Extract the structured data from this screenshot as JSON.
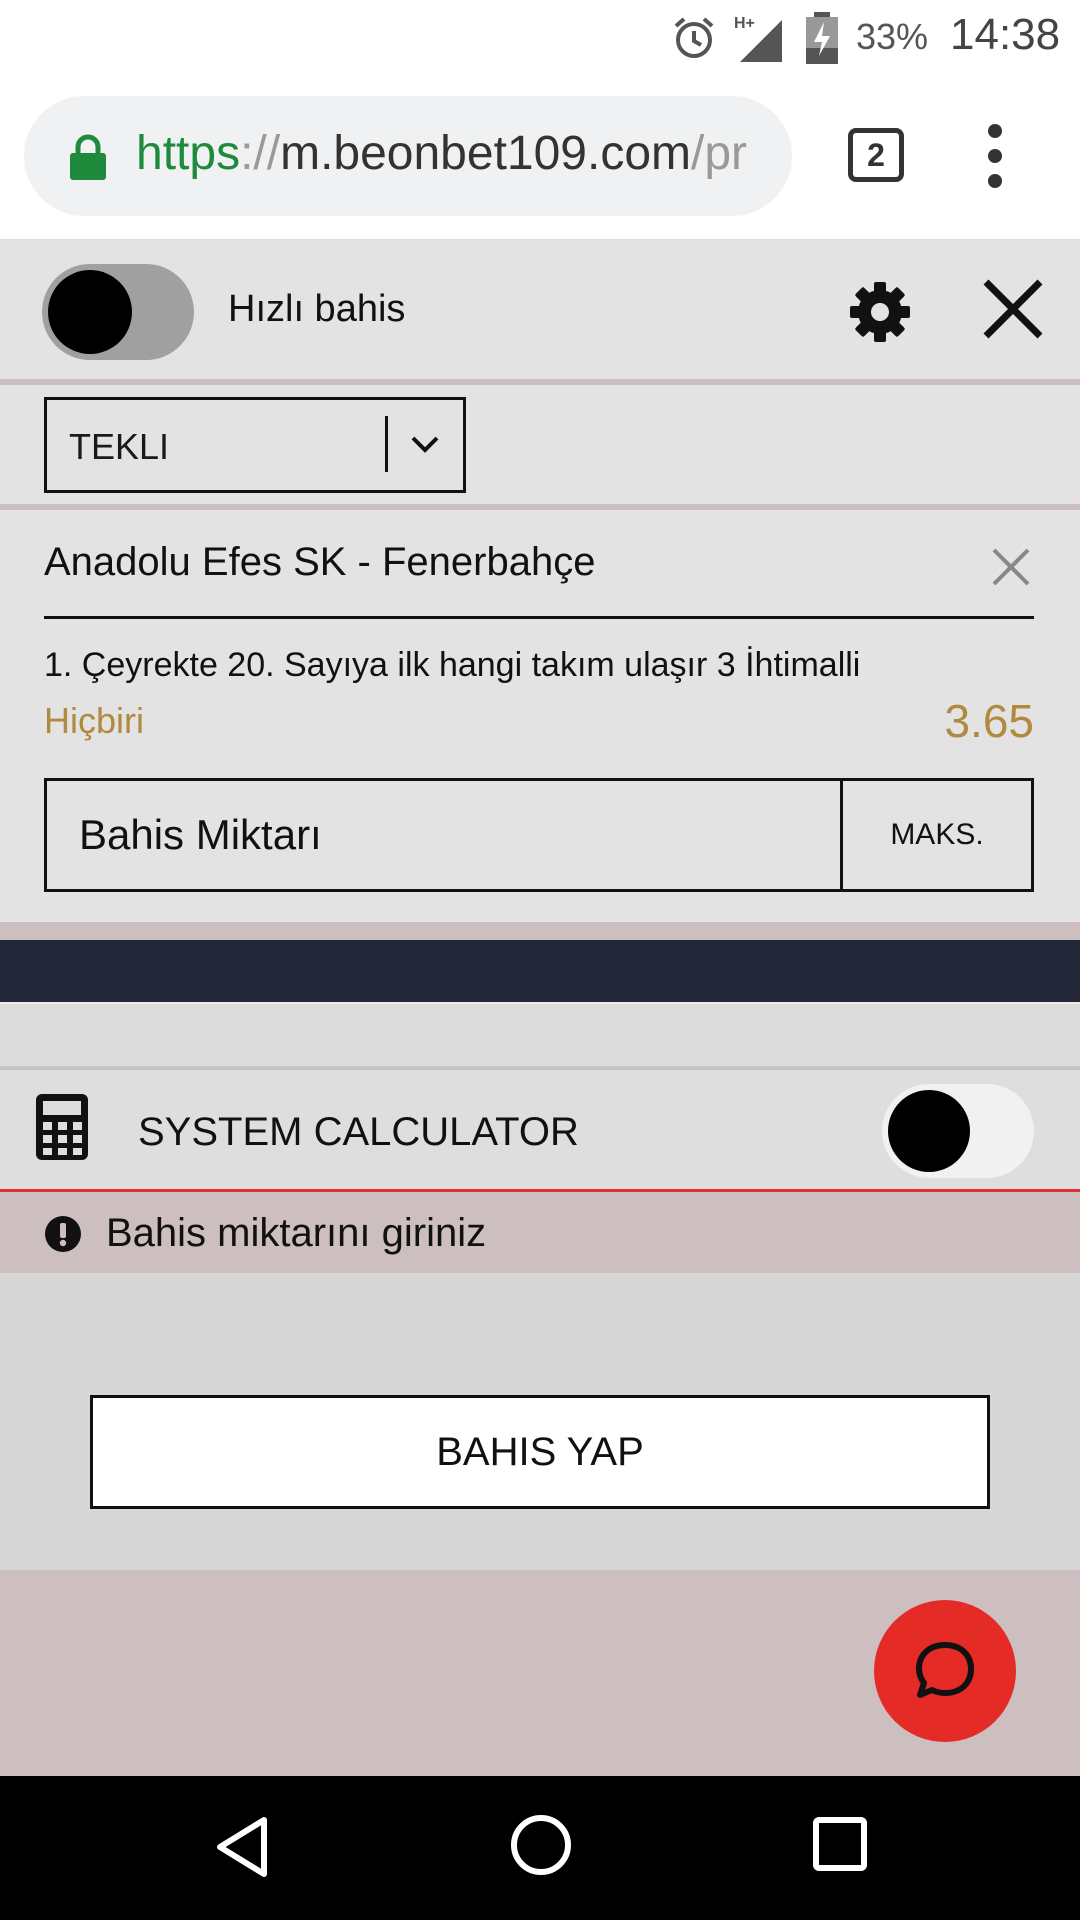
{
  "status_bar": {
    "battery": "33%",
    "time": "14:38",
    "network": "H+",
    "icons": [
      "alarm-icon",
      "signal-icon",
      "battery-charging-icon"
    ]
  },
  "browser": {
    "url_scheme": "https",
    "url_sep": "://",
    "url_host": "m.beonbet109.com",
    "url_path": "/pr",
    "tab_count": "2",
    "icons": [
      "lock-icon",
      "overflow-menu-icon"
    ]
  },
  "slip": {
    "quick_bet_label": "Hızlı bahis",
    "quick_bet_enabled": false,
    "bet_type": "TEKLI",
    "match": "Anadolu Efes SK - Fenerbahçe",
    "market": "1. Çeyrekte 20. Sayıya ilk hangi takım ulaşır 3 İhtimalli",
    "selection": "Hiçbiri",
    "odds": "3.65",
    "stake_placeholder": "Bahis Miktarı",
    "max_label": "MAKS.",
    "system_calculator_label": "SYSTEM CALCULATOR",
    "system_calculator_enabled": false,
    "warning": "Bahis miktarını giriniz",
    "place_bet_label": "BAHIS YAP"
  },
  "colors": {
    "accent_odds": "#b08a3e",
    "fab": "#e52b26",
    "dark_band": "#232636",
    "url_green": "#1e8a3c"
  }
}
